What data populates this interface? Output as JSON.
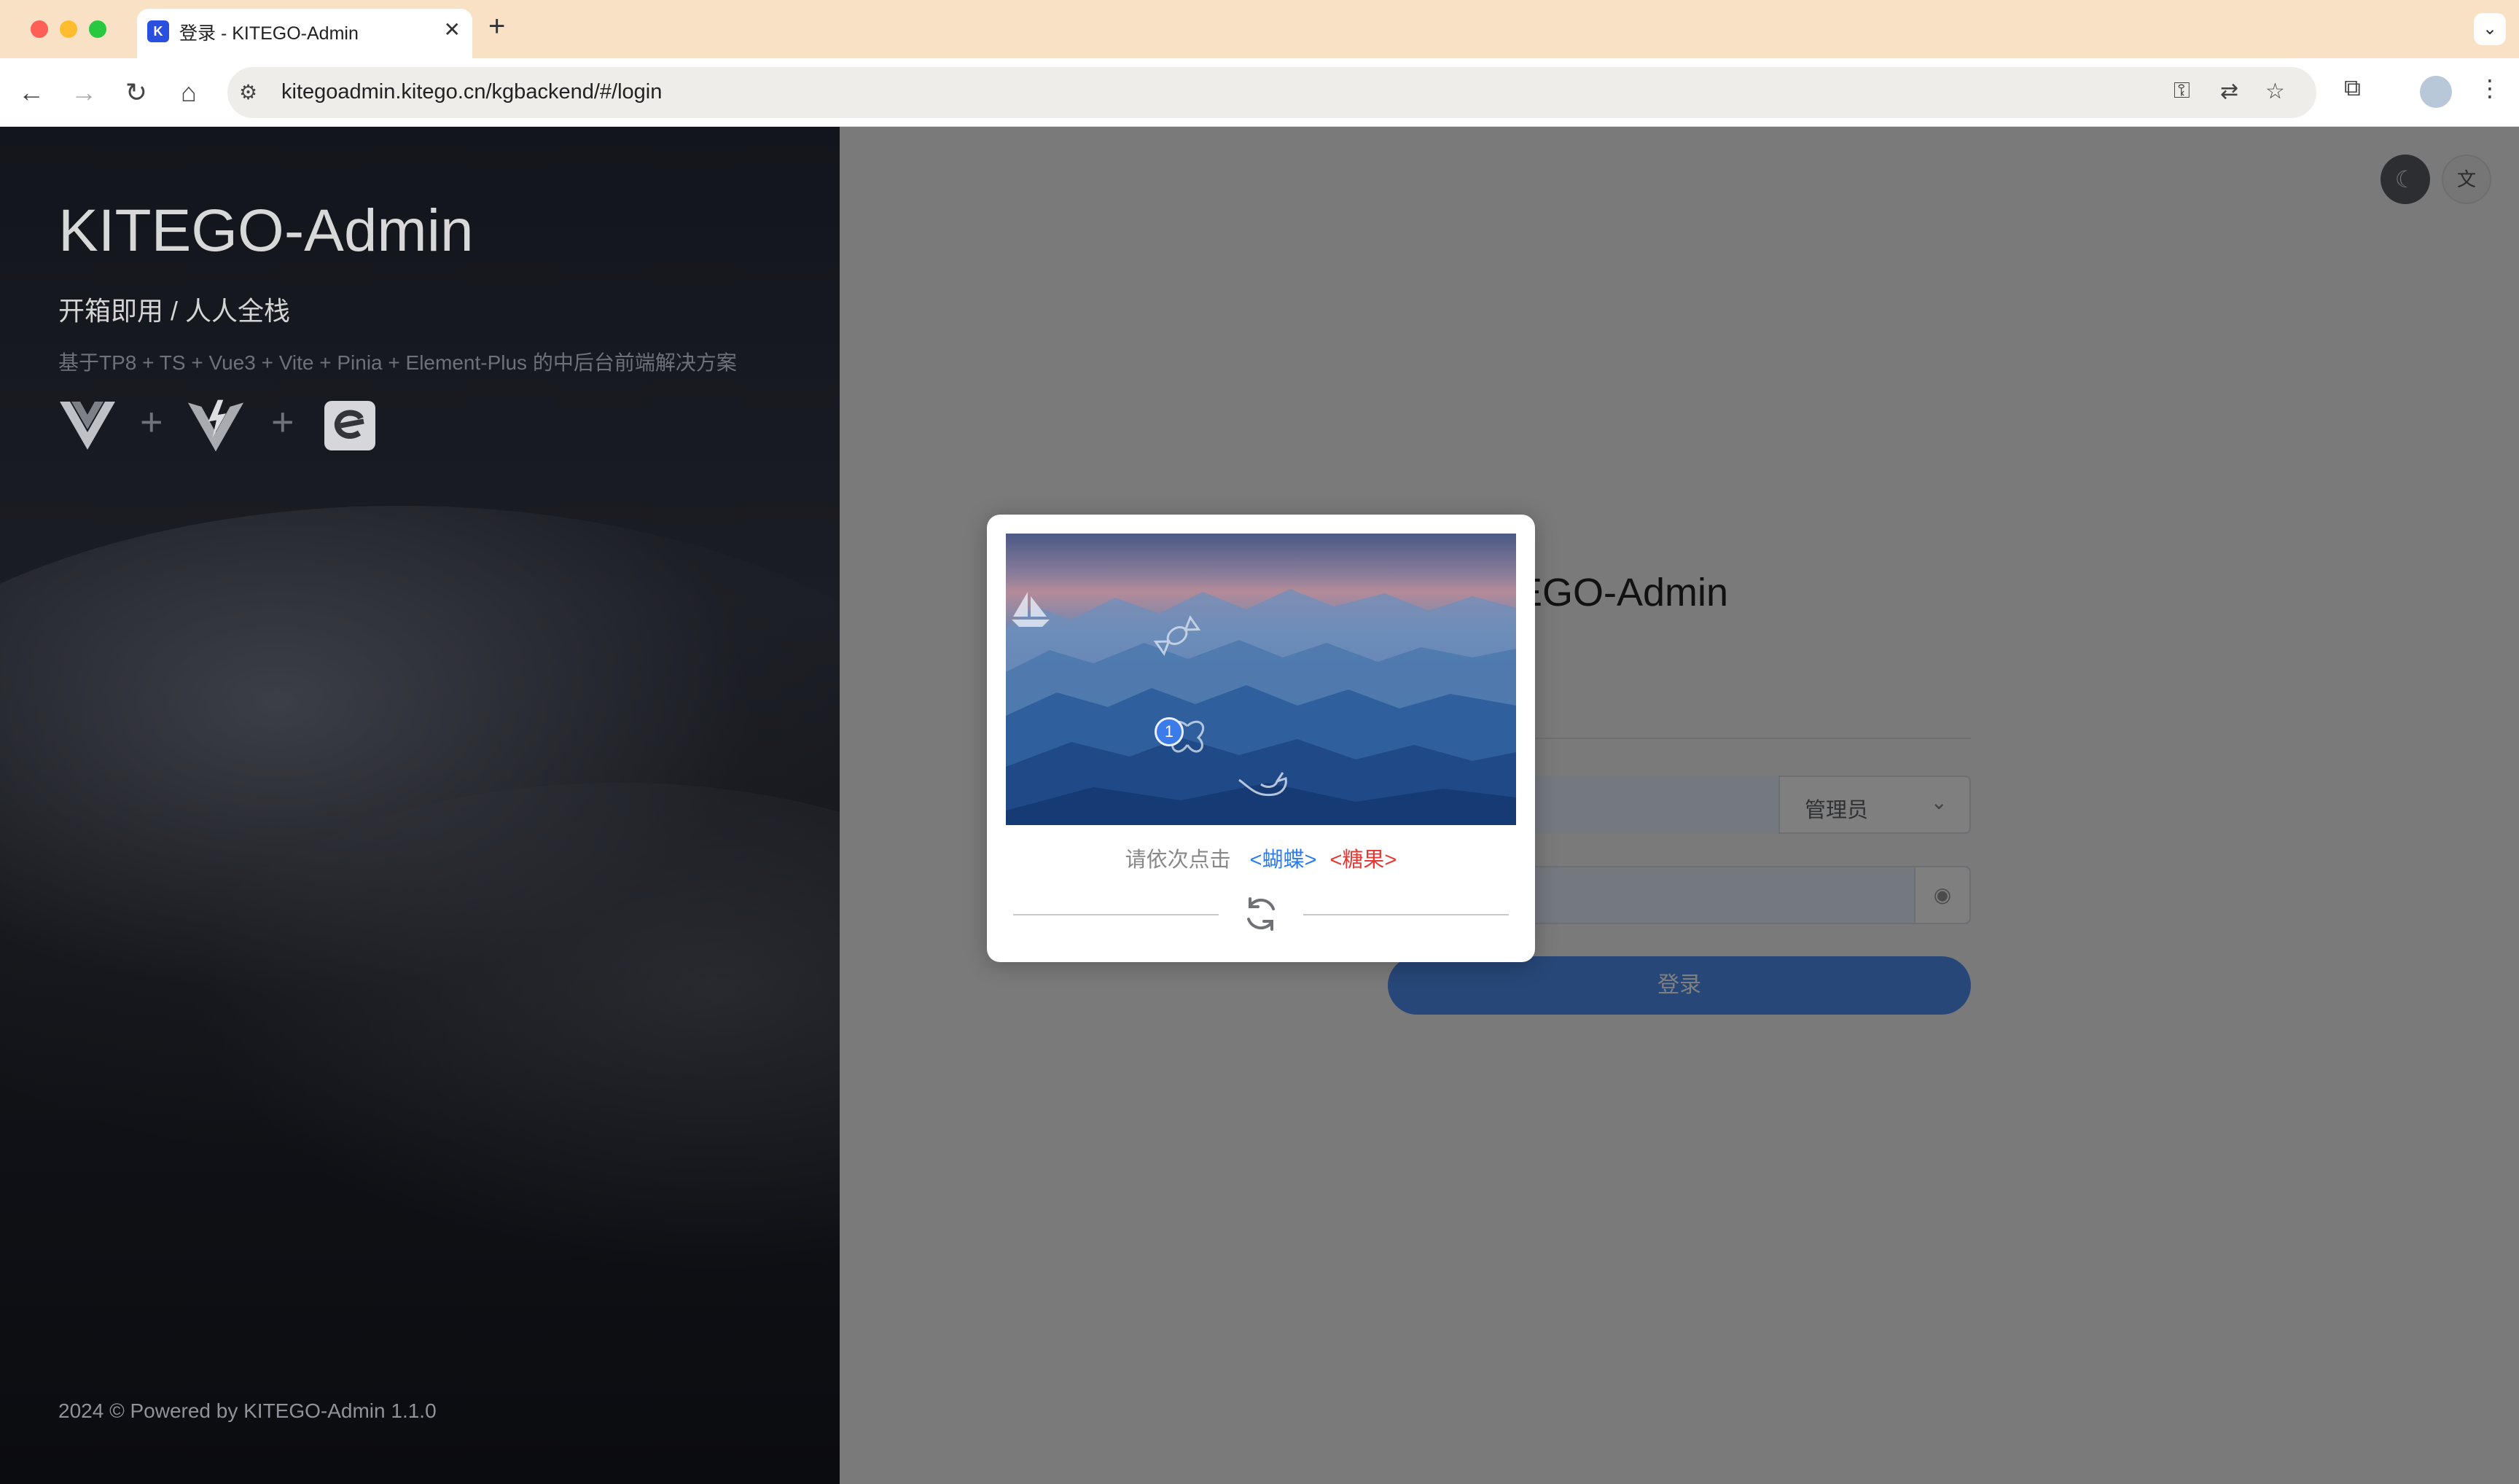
{
  "browser": {
    "tab_title": "登录 - KITEGO-Admin",
    "favicon_text": "K",
    "url": "kitegoadmin.kitego.cn/kgbackend/#/login",
    "traffic_colors": [
      "#ff5f57",
      "#febc2e",
      "#28c840"
    ],
    "nav_icons": [
      "back-icon",
      "forward-icon",
      "reload-icon",
      "home-icon"
    ],
    "omnibox_icons": [
      "key-icon",
      "translate-icon",
      "star-icon"
    ],
    "toolbar_icons": [
      "extensions-icon",
      "profile-avatar",
      "menu-icon"
    ]
  },
  "brand": {
    "title": "KITEGO-Admin",
    "slogan": "开箱即用 / 人人全栈",
    "description": "基于TP8 + TS + Vue3 + Vite + Pinia + Element-Plus 的中后台前端解决方案",
    "logos": [
      "vue-logo-icon",
      "vite-logo-icon",
      "element-plus-logo-icon"
    ],
    "plus": "+",
    "footer": "2024 © Powered by KITEGO-Admin 1.1.0"
  },
  "login": {
    "title": "KITEGO-Admin",
    "role_select": "管理员",
    "button_label": "登录",
    "accent_color": "#4e8ff0"
  },
  "captcha": {
    "prompt": "请依次点击",
    "targets": [
      "<蝴蝶>",
      "<糖果>"
    ],
    "target_colors": [
      "#2d7bf0",
      "#e53935"
    ],
    "click_marker": "1",
    "image_icons": [
      "boat-icon",
      "candy-icon",
      "butterfly-icon",
      "bird-icon"
    ]
  }
}
